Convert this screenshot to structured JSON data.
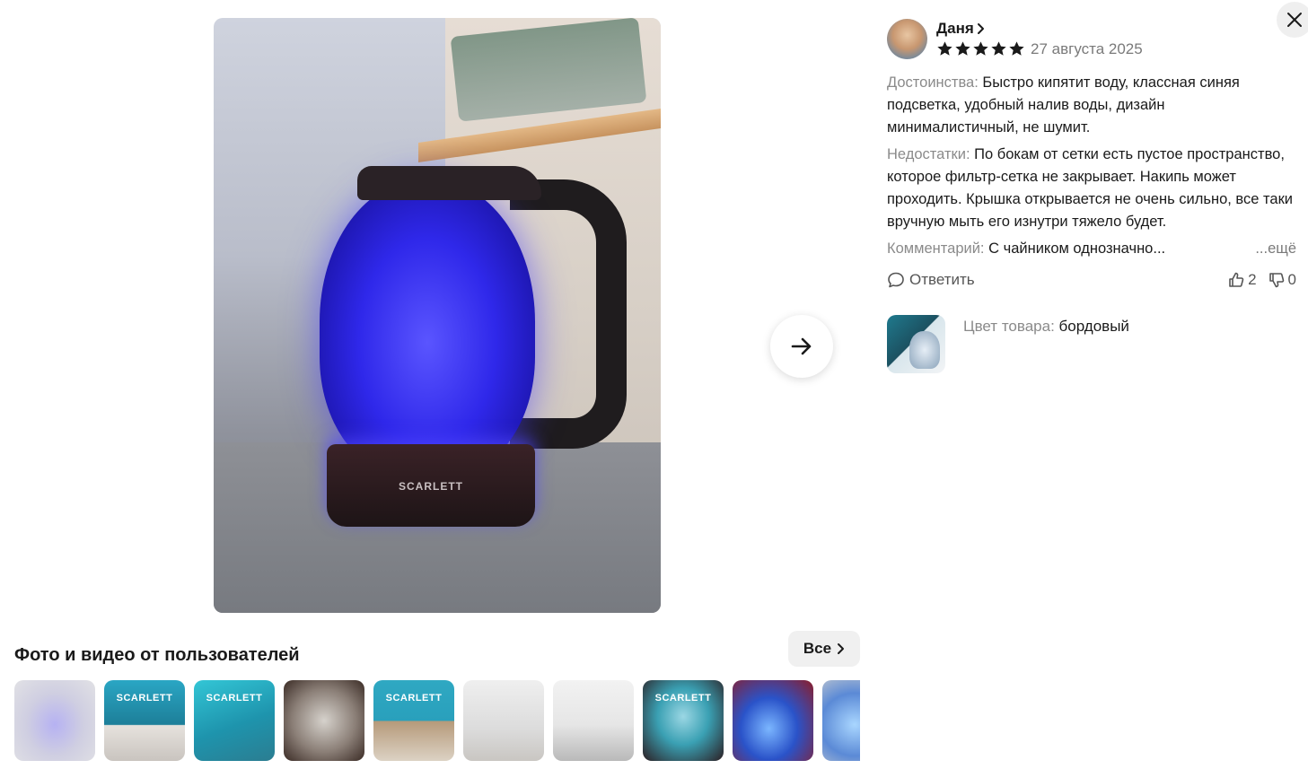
{
  "viewer": {
    "main_image_alt": "Электрический чайник SCARLETT с синей подсветкой",
    "main_image_brand": "SCARLETT",
    "next_icon": "arrow-right-icon",
    "close_icon": "close-icon"
  },
  "review": {
    "author_name": "Даня",
    "rating": 5,
    "rating_max": 5,
    "date": "27 августа 2025",
    "pros_label": "Достоинства:",
    "pros_text": "Быстро кипятит воду, классная синяя подсветка, удобный налив воды, дизайн минималистичный, не шумит.",
    "cons_label": "Недостатки:",
    "cons_text": "По бокам от сетки есть пустое пространство, которое фильтр-сетка не закрывает. Накипь может проходить. Крышка открывается не очень сильно, все таки вручную мыть его изнутри тяжело будет.",
    "comment_label": "Комментарий:",
    "comment_text": "С чайником однозначно...",
    "more_label": "...ещё",
    "reply_label": "Ответить",
    "likes": "2",
    "dislikes": "0",
    "product_color_label": "Цвет товара:",
    "product_color_value": "бордовый"
  },
  "gallery": {
    "title": "Фото и видео от пользователей",
    "all_label": "Все",
    "thumbnails": [
      {
        "label": ""
      },
      {
        "label": "SCARLETT"
      },
      {
        "label": "SCARLETT"
      },
      {
        "label": ""
      },
      {
        "label": "SCARLETT"
      },
      {
        "label": ""
      },
      {
        "label": ""
      },
      {
        "label": "SCARLETT"
      },
      {
        "label": ""
      },
      {
        "label": ""
      }
    ]
  },
  "colors": {
    "star": "#1a1a1a",
    "label_gray": "#8a8a8a",
    "glow_blue": "#2f28ea"
  }
}
